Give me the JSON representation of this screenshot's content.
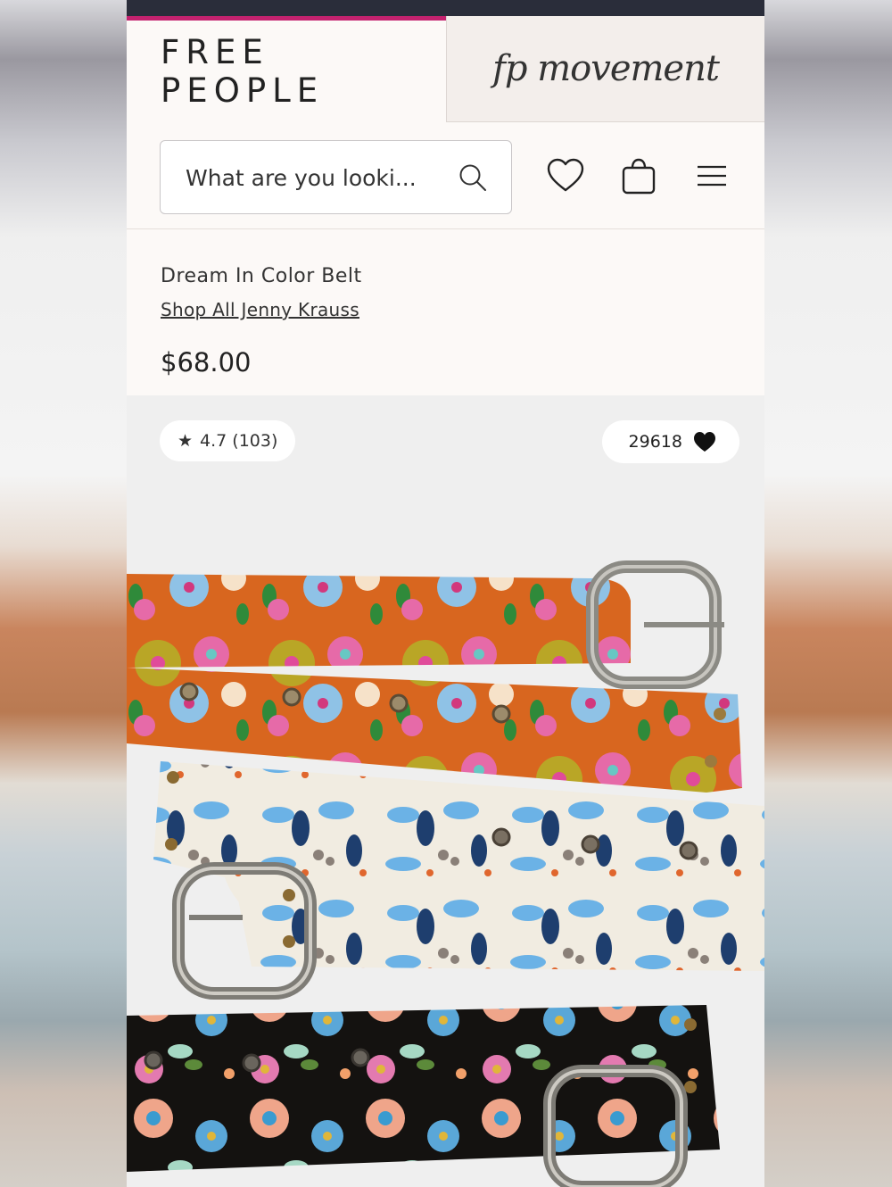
{
  "brand": {
    "primary_tab": "FREE PEOPLE",
    "secondary_tab": "fp movement",
    "accent_color": "#c4226f"
  },
  "header": {
    "search_placeholder": "What are you looki...",
    "icons": [
      "search-icon",
      "heart-icon",
      "bag-icon",
      "hamburger-menu-icon"
    ]
  },
  "product": {
    "title": "Dream In Color Belt",
    "brand_link": "Shop All Jenny Krauss",
    "price": "$68.00",
    "rating": "4.7 (103)",
    "likes": "29618"
  }
}
